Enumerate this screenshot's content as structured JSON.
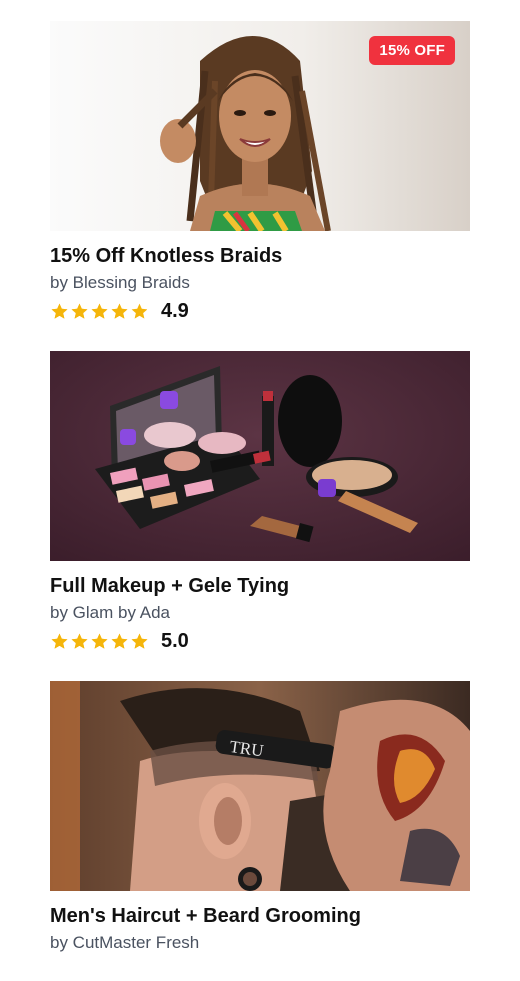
{
  "accent_color": "#f0323e",
  "star_color": "#f5b50a",
  "services": [
    {
      "image": "braids-model-photo",
      "badge": "15% OFF",
      "title": "15% Off Knotless Braids",
      "provider": "by Blessing Braids",
      "rating": "4.9",
      "rating_fraction": 0.98
    },
    {
      "image": "makeup-products-photo",
      "badge": "",
      "title": "Full Makeup + Gele Tying",
      "provider": "by Glam by Ada",
      "rating": "5.0",
      "rating_fraction": 1.0
    },
    {
      "image": "barber-haircut-photo",
      "badge": "",
      "title": "Men's Haircut + Beard Grooming",
      "provider": "by CutMaster Fresh",
      "rating": "",
      "rating_fraction": null
    }
  ]
}
